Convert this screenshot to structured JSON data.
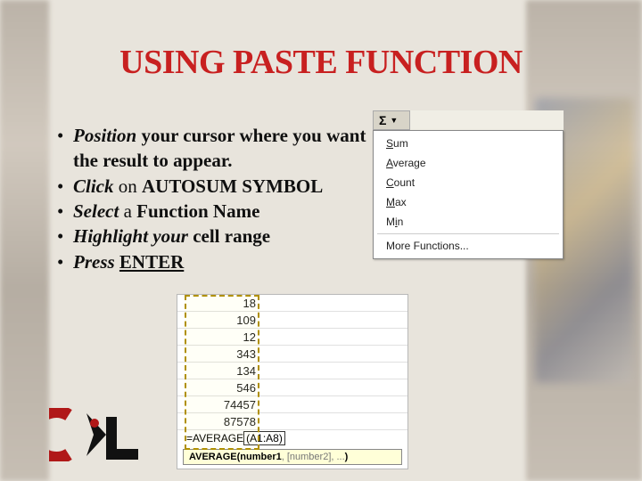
{
  "title": "USING PASTE FUNCTION",
  "bullets": [
    {
      "em": "Position",
      "rest": " your cursor where you want the result to appear."
    },
    {
      "em": "Click",
      "rest_pre": " on ",
      "strong": "AUTOSUM SYMBOL"
    },
    {
      "em": "Select",
      "rest_pre": " a ",
      "strong": "Function Name"
    },
    {
      "em": "Highlight your",
      "rest": " cell range"
    },
    {
      "em": "Press",
      "rest_pre": " ",
      "strong_u": "ENTER"
    }
  ],
  "autosum": {
    "sigma": "Σ",
    "items": [
      "Sum",
      "Average",
      "Count",
      "Max",
      "Min"
    ],
    "more": "More Functions..."
  },
  "sheet": {
    "values": [
      "18",
      "109",
      "12",
      "343",
      "134",
      "546",
      "74457",
      "87578"
    ],
    "formula_fn": "=AVERAGE",
    "formula_ref": "(A1:A8)",
    "tooltip_fn": "AVERAGE",
    "tooltip_sig": "(number1, [number2], ...)"
  }
}
